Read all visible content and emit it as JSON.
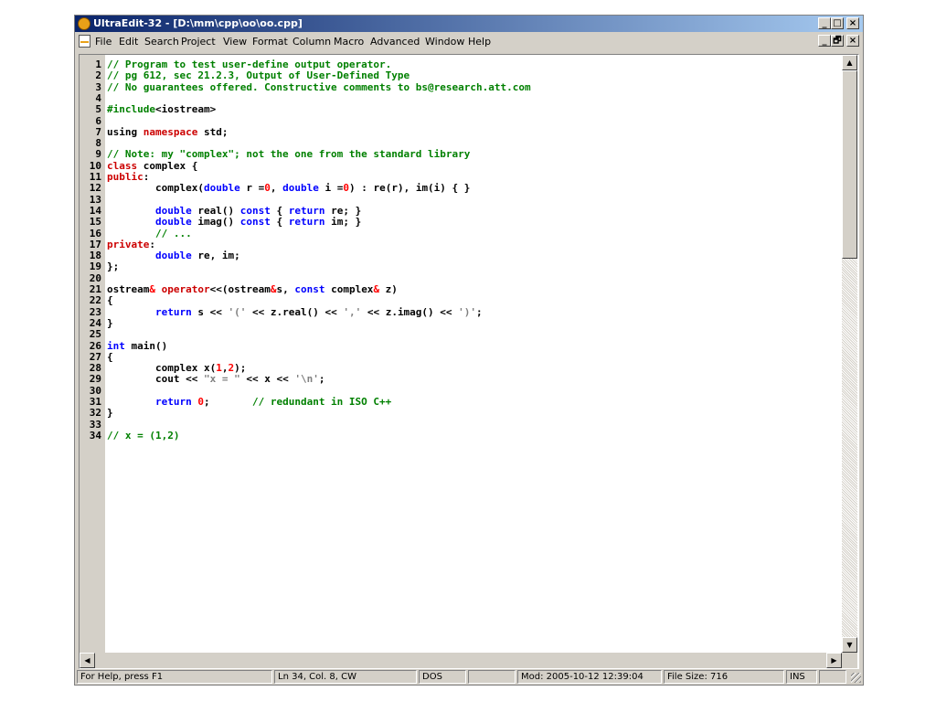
{
  "window": {
    "title": "UltraEdit-32 - [D:\\mm\\cpp\\oo\\oo.cpp]"
  },
  "caption_buttons": {
    "minimize": "_",
    "maximize": "□",
    "close": "×"
  },
  "mdi_buttons": {
    "minimize": "_",
    "restore": "🗗",
    "close": "×"
  },
  "menu": {
    "items": [
      "File",
      "Edit",
      "Search",
      "Project",
      "View",
      "Format",
      "Column",
      "Macro",
      "Advanced",
      "Window",
      "Help"
    ]
  },
  "colors": {
    "comment": "#008000",
    "keyword": "#0000ff",
    "type_kw": "#cc0000",
    "number": "#ff0000",
    "string": "#808080",
    "directive": "#008000",
    "plain": "#000000"
  },
  "code": {
    "line_numbers": [
      "1",
      "2",
      "3",
      "4",
      "5",
      "6",
      "7",
      "8",
      "9",
      "10",
      "11",
      "12",
      "13",
      "14",
      "15",
      "16",
      "17",
      "18",
      "19",
      "20",
      "21",
      "22",
      "23",
      "24",
      "25",
      "26",
      "27",
      "28",
      "29",
      "30",
      "31",
      "32",
      "33",
      "34"
    ],
    "lines": [
      [
        {
          "t": "// Program to test user-define output operator.",
          "c": "comment"
        }
      ],
      [
        {
          "t": "// pg 612, sec 21.2.3, Output of User-Defined Type",
          "c": "comment"
        }
      ],
      [
        {
          "t": "// No guarantees offered. Constructive comments to bs@research.att.com",
          "c": "comment"
        }
      ],
      [],
      [
        {
          "t": "#include",
          "c": "directive"
        },
        {
          "t": "<iostream>",
          "c": "plain"
        }
      ],
      [],
      [
        {
          "t": "using ",
          "c": "plain"
        },
        {
          "t": "namespace",
          "c": "type_kw"
        },
        {
          "t": " std;",
          "c": "plain"
        }
      ],
      [],
      [
        {
          "t": "// Note: my \"complex\"; not the one from the standard library",
          "c": "comment"
        }
      ],
      [
        {
          "t": "class",
          "c": "type_kw"
        },
        {
          "t": " complex {",
          "c": "plain"
        }
      ],
      [
        {
          "t": "public",
          "c": "type_kw"
        },
        {
          "t": ":",
          "c": "plain"
        }
      ],
      [
        {
          "t": "        complex(",
          "c": "plain"
        },
        {
          "t": "double",
          "c": "keyword"
        },
        {
          "t": " r =",
          "c": "plain"
        },
        {
          "t": "0",
          "c": "number"
        },
        {
          "t": ", ",
          "c": "plain"
        },
        {
          "t": "double",
          "c": "keyword"
        },
        {
          "t": " i =",
          "c": "plain"
        },
        {
          "t": "0",
          "c": "number"
        },
        {
          "t": ") : re(r), im(i) { }",
          "c": "plain"
        }
      ],
      [],
      [
        {
          "t": "        ",
          "c": "plain"
        },
        {
          "t": "double",
          "c": "keyword"
        },
        {
          "t": " real() ",
          "c": "plain"
        },
        {
          "t": "const",
          "c": "keyword"
        },
        {
          "t": " { ",
          "c": "plain"
        },
        {
          "t": "return",
          "c": "keyword"
        },
        {
          "t": " re; }",
          "c": "plain"
        }
      ],
      [
        {
          "t": "        ",
          "c": "plain"
        },
        {
          "t": "double",
          "c": "keyword"
        },
        {
          "t": " imag() ",
          "c": "plain"
        },
        {
          "t": "const",
          "c": "keyword"
        },
        {
          "t": " { ",
          "c": "plain"
        },
        {
          "t": "return",
          "c": "keyword"
        },
        {
          "t": " im; }",
          "c": "plain"
        }
      ],
      [
        {
          "t": "        // ...",
          "c": "comment"
        }
      ],
      [
        {
          "t": "private",
          "c": "type_kw"
        },
        {
          "t": ":",
          "c": "plain"
        }
      ],
      [
        {
          "t": "        ",
          "c": "plain"
        },
        {
          "t": "double",
          "c": "keyword"
        },
        {
          "t": " re, im;",
          "c": "plain"
        }
      ],
      [
        {
          "t": "};",
          "c": "plain"
        }
      ],
      [],
      [
        {
          "t": "ostream",
          "c": "plain"
        },
        {
          "t": "&",
          "c": "number"
        },
        {
          "t": " ",
          "c": "plain"
        },
        {
          "t": "operator",
          "c": "type_kw"
        },
        {
          "t": "<<(ostream",
          "c": "plain"
        },
        {
          "t": "&",
          "c": "number"
        },
        {
          "t": "s, ",
          "c": "plain"
        },
        {
          "t": "const",
          "c": "keyword"
        },
        {
          "t": " complex",
          "c": "plain"
        },
        {
          "t": "&",
          "c": "number"
        },
        {
          "t": " z)",
          "c": "plain"
        }
      ],
      [
        {
          "t": "{",
          "c": "plain"
        }
      ],
      [
        {
          "t": "        ",
          "c": "plain"
        },
        {
          "t": "return",
          "c": "keyword"
        },
        {
          "t": " s << ",
          "c": "plain"
        },
        {
          "t": "'('",
          "c": "string"
        },
        {
          "t": " << z.real() << ",
          "c": "plain"
        },
        {
          "t": "','",
          "c": "string"
        },
        {
          "t": " << z.imag() << ",
          "c": "plain"
        },
        {
          "t": "')'",
          "c": "string"
        },
        {
          "t": ";",
          "c": "plain"
        }
      ],
      [
        {
          "t": "}",
          "c": "plain"
        }
      ],
      [],
      [
        {
          "t": "int",
          "c": "keyword"
        },
        {
          "t": " main()",
          "c": "plain"
        }
      ],
      [
        {
          "t": "{",
          "c": "plain"
        }
      ],
      [
        {
          "t": "        complex x(",
          "c": "plain"
        },
        {
          "t": "1",
          "c": "number"
        },
        {
          "t": ",",
          "c": "plain"
        },
        {
          "t": "2",
          "c": "number"
        },
        {
          "t": ");",
          "c": "plain"
        }
      ],
      [
        {
          "t": "        cout << ",
          "c": "plain"
        },
        {
          "t": "\"x = \"",
          "c": "string"
        },
        {
          "t": " << x << ",
          "c": "plain"
        },
        {
          "t": "'\\n'",
          "c": "string"
        },
        {
          "t": ";",
          "c": "plain"
        }
      ],
      [],
      [
        {
          "t": "        ",
          "c": "plain"
        },
        {
          "t": "return",
          "c": "keyword"
        },
        {
          "t": " ",
          "c": "plain"
        },
        {
          "t": "0",
          "c": "number"
        },
        {
          "t": ";       ",
          "c": "plain"
        },
        {
          "t": "// redundant in ISO C++",
          "c": "comment"
        }
      ],
      [
        {
          "t": "}",
          "c": "plain"
        }
      ],
      [],
      [
        {
          "t": "// x = (1,2)",
          "c": "comment"
        }
      ]
    ]
  },
  "scrollbar": {
    "up": "▲",
    "down": "▼",
    "left": "◀",
    "right": "▶"
  },
  "status": {
    "help": "For Help, press F1",
    "position": "Ln 34, Col. 8, CW",
    "format": "DOS",
    "empty": "",
    "modified": "Mod: 2005-10-12 12:39:04",
    "filesize": "File Size: 716",
    "mode": "INS",
    "empty2": ""
  }
}
